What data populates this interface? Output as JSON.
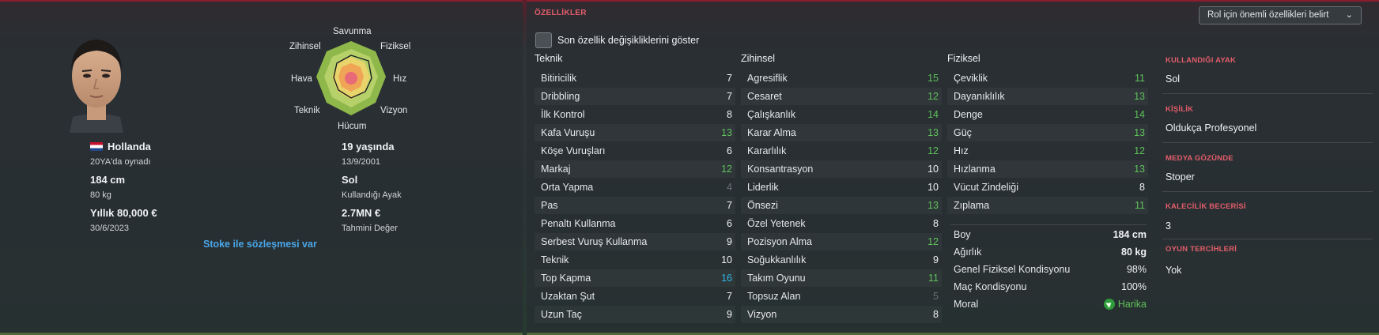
{
  "profile": {
    "nationality": "Hollanda",
    "caps": "20YA'da oynadı",
    "height": "184 cm",
    "weight": "80 kg",
    "wage": "Yıllık 80,000 €",
    "contract_end": "30/6/2023",
    "age": "19 yaşında",
    "birth_date": "13/9/2001",
    "foot": "Sol",
    "foot_caption": "Kullandığı Ayak",
    "value": "2.7MN €",
    "value_caption": "Tahmini Değer",
    "contract_link": "Stoke ile sözleşmesi var"
  },
  "radar": {
    "labels": [
      "Savunma",
      "Fiziksel",
      "Hız",
      "Vizyon",
      "Hücum",
      "Teknik",
      "Hava",
      "Zihinsel"
    ]
  },
  "attributes": {
    "title": "ÖZELLİKLER",
    "role_dropdown": "Rol için önemli özellikleri belirt",
    "toggle_label": "Son özellik değişikliklerini göster",
    "columns": [
      {
        "title": "Teknik",
        "items": [
          {
            "name": "Bitiricilik",
            "value": "7",
            "tone": "white"
          },
          {
            "name": "Dribbling",
            "value": "7",
            "tone": "white"
          },
          {
            "name": "İlk Kontrol",
            "value": "8",
            "tone": "white"
          },
          {
            "name": "Kafa Vuruşu",
            "value": "13",
            "tone": "green"
          },
          {
            "name": "Köşe Vuruşları",
            "value": "6",
            "tone": "white"
          },
          {
            "name": "Markaj",
            "value": "12",
            "tone": "green"
          },
          {
            "name": "Orta Yapma",
            "value": "4",
            "tone": "dim"
          },
          {
            "name": "Pas",
            "value": "7",
            "tone": "white"
          },
          {
            "name": "Penaltı Kullanma",
            "value": "6",
            "tone": "white"
          },
          {
            "name": "Serbest Vuruş Kullanma",
            "value": "9",
            "tone": "white"
          },
          {
            "name": "Teknik",
            "value": "10",
            "tone": "white"
          },
          {
            "name": "Top Kapma",
            "value": "16",
            "tone": "blue"
          },
          {
            "name": "Uzaktan Şut",
            "value": "7",
            "tone": "white"
          },
          {
            "name": "Uzun Taç",
            "value": "9",
            "tone": "white"
          }
        ]
      },
      {
        "title": "Zihinsel",
        "items": [
          {
            "name": "Agresiflik",
            "value": "15",
            "tone": "green"
          },
          {
            "name": "Cesaret",
            "value": "12",
            "tone": "green"
          },
          {
            "name": "Çalışkanlık",
            "value": "14",
            "tone": "green"
          },
          {
            "name": "Karar Alma",
            "value": "13",
            "tone": "green"
          },
          {
            "name": "Kararlılık",
            "value": "12",
            "tone": "green"
          },
          {
            "name": "Konsantrasyon",
            "value": "10",
            "tone": "white"
          },
          {
            "name": "Liderlik",
            "value": "10",
            "tone": "white"
          },
          {
            "name": "Önsezi",
            "value": "13",
            "tone": "green"
          },
          {
            "name": "Özel Yetenek",
            "value": "8",
            "tone": "white"
          },
          {
            "name": "Pozisyon Alma",
            "value": "12",
            "tone": "green"
          },
          {
            "name": "Soğukkanlılık",
            "value": "9",
            "tone": "white"
          },
          {
            "name": "Takım Oyunu",
            "value": "11",
            "tone": "green"
          },
          {
            "name": "Topsuz Alan",
            "value": "5",
            "tone": "dim"
          },
          {
            "name": "Vizyon",
            "value": "8",
            "tone": "white"
          }
        ]
      },
      {
        "title": "Fiziksel",
        "items": [
          {
            "name": "Çeviklik",
            "value": "11",
            "tone": "green"
          },
          {
            "name": "Dayanıklılık",
            "value": "13",
            "tone": "green"
          },
          {
            "name": "Denge",
            "value": "14",
            "tone": "green"
          },
          {
            "name": "Güç",
            "value": "13",
            "tone": "green"
          },
          {
            "name": "Hız",
            "value": "12",
            "tone": "green"
          },
          {
            "name": "Hızlanma",
            "value": "13",
            "tone": "green"
          },
          {
            "name": "Vücut Zindeliği",
            "value": "8",
            "tone": "white"
          },
          {
            "name": "Zıplama",
            "value": "11",
            "tone": "green"
          }
        ]
      }
    ]
  },
  "physical_info": [
    {
      "label": "Boy",
      "value": "184 cm"
    },
    {
      "label": "Ağırlık",
      "value": "80 kg"
    },
    {
      "label": "Genel Fiziksel Kondisyonu",
      "value": "98%"
    },
    {
      "label": "Maç Kondisyonu",
      "value": "100%"
    },
    {
      "label": "Moral",
      "value": "Harika"
    }
  ],
  "side": [
    {
      "heading": "KULLANDIĞI AYAK",
      "value": "Sol"
    },
    {
      "heading": "KİŞİLİK",
      "value": "Oldukça Profesyonel"
    },
    {
      "heading": "MEDYA GÖZÜNDE",
      "value": "Stoper"
    },
    {
      "heading": "KALECİLİK BECERİSİ",
      "value": "3"
    },
    {
      "heading": "OYUN TERCİHLERİ",
      "value": "Yok"
    }
  ],
  "colors": {
    "accent_red": "#e35d6a",
    "value_green": "#5fc25a",
    "value_blue": "#2fb6e6",
    "value_dim": "#6a7075",
    "link_blue": "#4aa6e8"
  }
}
